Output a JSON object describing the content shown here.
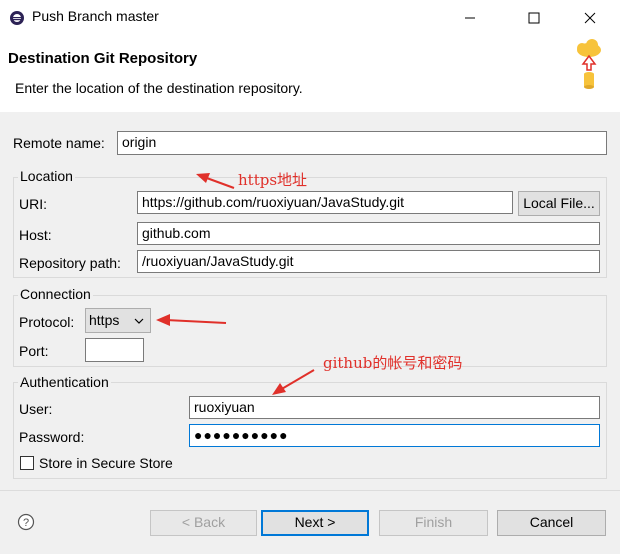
{
  "window": {
    "title": "Push Branch master"
  },
  "header": {
    "title": "Destination Git Repository",
    "description": "Enter the location of the destination repository."
  },
  "remote": {
    "label": "Remote name:",
    "value": "origin"
  },
  "location": {
    "group_label": "Location",
    "uri_label": "URI:",
    "uri_value": "https://github.com/ruoxiyuan/JavaStudy.git",
    "local_file_button": "Local File...",
    "host_label": "Host:",
    "host_value": "github.com",
    "repo_path_label": "Repository path:",
    "repo_path_value": "/ruoxiyuan/JavaStudy.git"
  },
  "connection": {
    "group_label": "Connection",
    "protocol_label": "Protocol:",
    "protocol_value": "https",
    "port_label": "Port:",
    "port_value": ""
  },
  "authentication": {
    "group_label": "Authentication",
    "user_label": "User:",
    "user_value": "ruoxiyuan",
    "password_label": "Password:",
    "password_value": "●●●●●●●●●●",
    "store_label": "Store in Secure Store",
    "store_checked": false
  },
  "annotations": {
    "https_note": "https地址",
    "account_note": "github的帐号和密码",
    "color": "#e0302a"
  },
  "footer": {
    "back_label": "< Back",
    "next_label": "Next >",
    "finish_label": "Finish",
    "cancel_label": "Cancel"
  }
}
